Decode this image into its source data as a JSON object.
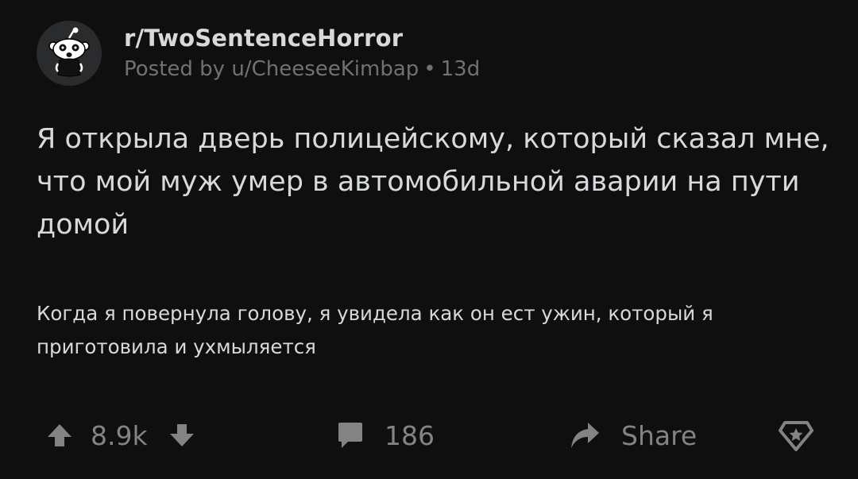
{
  "header": {
    "subreddit": "r/TwoSentenceHorror",
    "posted_by_prefix": "Posted by",
    "author": "u/CheeseeKimbap",
    "separator": "•",
    "age": "13d",
    "avatar_icon": "reddit-snoo-icon"
  },
  "post": {
    "title": "Я открыла дверь полицейскому, который сказал мне, что мой муж умер в автомобильной аварии на пути домой",
    "body": "Когда я повернула голову, я увидела как он ест ужин, который я приготовила и ухмыляется"
  },
  "actions": {
    "upvote_icon": "arrow-up-icon",
    "score": "8.9k",
    "downvote_icon": "arrow-down-icon",
    "comment_icon": "comment-bubble-icon",
    "comments_count": "186",
    "share_icon": "share-arrow-icon",
    "share_label": "Share",
    "award_icon": "award-icon"
  },
  "colors": {
    "background": "#0f0f10",
    "text": "#d7dadc",
    "muted": "#818384",
    "meta": "#6f7173"
  }
}
